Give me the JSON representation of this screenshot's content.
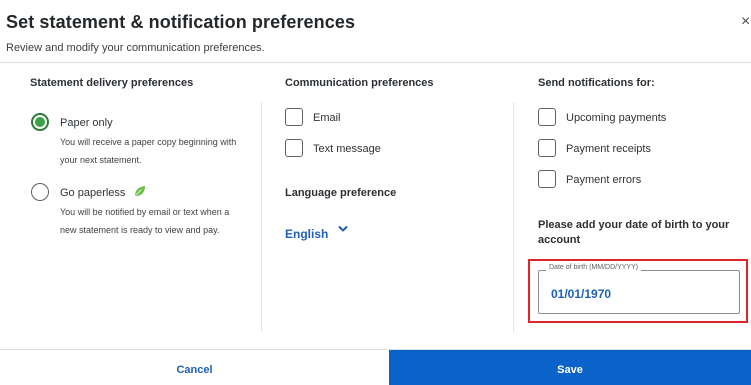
{
  "dialog": {
    "title": "Set statement & notification preferences",
    "subtitle": "Review and modify your communication preferences.",
    "close_glyph": "×"
  },
  "statement": {
    "heading": "Statement delivery preferences",
    "options": [
      {
        "label": "Paper only",
        "description": "You will receive a paper copy beginning with your next statement.",
        "checked": true
      },
      {
        "label": "Go paperless",
        "description": "You will be notified by email or text when a new statement is ready to view and pay.",
        "checked": false,
        "icon": "leaf-icon"
      }
    ]
  },
  "communication": {
    "heading": "Communication preferences",
    "options": [
      {
        "label": "Email",
        "checked": false
      },
      {
        "label": "Text message",
        "checked": false
      }
    ],
    "language": {
      "heading": "Language preference",
      "value": "English"
    }
  },
  "notifications": {
    "heading": "Send notifications for:",
    "options": [
      {
        "label": "Upcoming payments",
        "checked": false
      },
      {
        "label": "Payment receipts",
        "checked": false
      },
      {
        "label": "Payment errors",
        "checked": false
      }
    ],
    "dob": {
      "message": "Please add your date of birth to your account",
      "label": "Date of birth (MM/DD/YYYY)",
      "value": "01/01/1970"
    }
  },
  "footer": {
    "cancel_label": "Cancel",
    "save_label": "Save"
  },
  "colors": {
    "accent": "#0b63c9",
    "link": "#1f5fb8",
    "radio_selected": "#3aa244",
    "highlight": "#e0242b"
  }
}
